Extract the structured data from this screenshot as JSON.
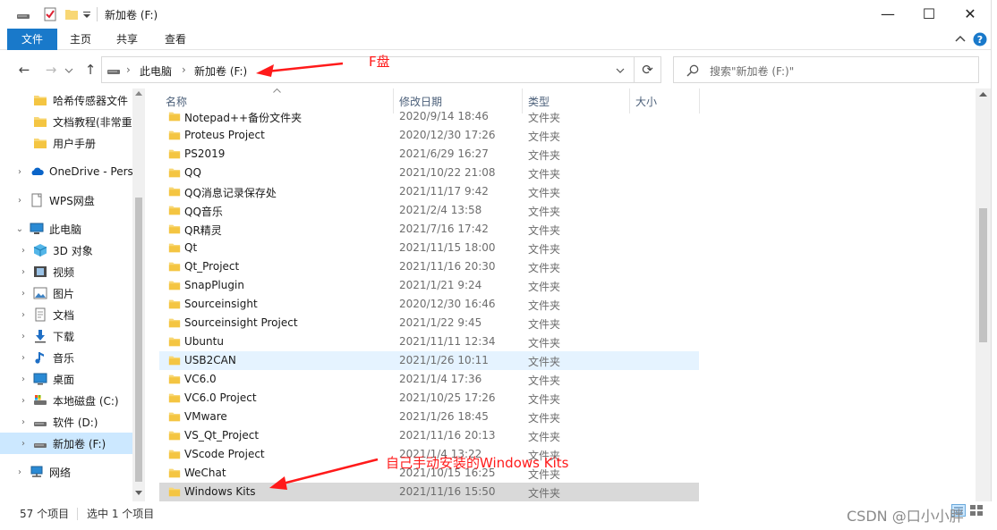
{
  "window": {
    "title": "新加卷 (F:)",
    "minimize_glyph": "—",
    "maximize_glyph": "☐",
    "close_glyph": "✕"
  },
  "ribbon": {
    "tabs": [
      {
        "label": "文件"
      },
      {
        "label": "主页"
      },
      {
        "label": "共享"
      },
      {
        "label": "查看"
      }
    ]
  },
  "nav": {
    "back_glyph": "←",
    "forward_glyph": "→",
    "up_glyph": "↑",
    "refresh_glyph": "⟳",
    "breadcrumb": [
      "此电脑",
      "新加卷 (F:)"
    ],
    "search_placeholder": "搜索\"新加卷 (F:)\""
  },
  "sidebar": {
    "items": [
      {
        "label": "哈希传感器文件",
        "icon": "folder-icon"
      },
      {
        "label": "文档教程(非常重",
        "icon": "folder-icon"
      },
      {
        "label": "用户手册",
        "icon": "folder-icon"
      },
      {
        "label": "OneDrive - Perso",
        "icon": "cloud-icon"
      },
      {
        "label": "WPS网盘",
        "icon": "cloud-drive-icon"
      },
      {
        "label": "此电脑",
        "icon": "computer-icon"
      },
      {
        "label": "3D 对象",
        "icon": "cube-icon"
      },
      {
        "label": "视频",
        "icon": "video-icon"
      },
      {
        "label": "图片",
        "icon": "picture-icon"
      },
      {
        "label": "文档",
        "icon": "document-icon"
      },
      {
        "label": "下载",
        "icon": "download-icon"
      },
      {
        "label": "音乐",
        "icon": "music-icon"
      },
      {
        "label": "桌面",
        "icon": "desktop-icon"
      },
      {
        "label": "本地磁盘 (C:)",
        "icon": "system-drive-icon"
      },
      {
        "label": "软件 (D:)",
        "icon": "drive-icon"
      },
      {
        "label": "新加卷 (F:)",
        "icon": "drive-icon"
      },
      {
        "label": "网络",
        "icon": "network-icon"
      }
    ]
  },
  "columns": {
    "name": "名称",
    "date": "修改日期",
    "type": "类型",
    "size": "大小"
  },
  "files": [
    {
      "name": "Notepad++备份文件夹",
      "date": "2020/9/14 18:46",
      "type": "文件夹"
    },
    {
      "name": "Proteus Project",
      "date": "2020/12/30 17:26",
      "type": "文件夹"
    },
    {
      "name": "PS2019",
      "date": "2021/6/29 16:27",
      "type": "文件夹"
    },
    {
      "name": "QQ",
      "date": "2021/10/22 21:08",
      "type": "文件夹"
    },
    {
      "name": "QQ消息记录保存处",
      "date": "2021/11/17 9:42",
      "type": "文件夹"
    },
    {
      "name": "QQ音乐",
      "date": "2021/2/4 13:58",
      "type": "文件夹"
    },
    {
      "name": "QR精灵",
      "date": "2021/7/16 17:42",
      "type": "文件夹"
    },
    {
      "name": "Qt",
      "date": "2021/11/15 18:00",
      "type": "文件夹"
    },
    {
      "name": "Qt_Project",
      "date": "2021/11/16 20:30",
      "type": "文件夹"
    },
    {
      "name": "SnapPlugin",
      "date": "2021/1/21 9:24",
      "type": "文件夹"
    },
    {
      "name": "Sourceinsight",
      "date": "2020/12/30 16:46",
      "type": "文件夹"
    },
    {
      "name": "Sourceinsight Project",
      "date": "2021/1/22 9:45",
      "type": "文件夹"
    },
    {
      "name": "Ubuntu",
      "date": "2021/11/11 12:34",
      "type": "文件夹"
    },
    {
      "name": "USB2CAN",
      "date": "2021/1/26 10:11",
      "type": "文件夹"
    },
    {
      "name": "VC6.0",
      "date": "2021/1/4 17:36",
      "type": "文件夹"
    },
    {
      "name": "VC6.0 Project",
      "date": "2021/10/25 17:26",
      "type": "文件夹"
    },
    {
      "name": "VMware",
      "date": "2021/1/26 18:45",
      "type": "文件夹"
    },
    {
      "name": "VS_Qt_Project",
      "date": "2021/11/16 20:13",
      "type": "文件夹"
    },
    {
      "name": "VScode Project",
      "date": "2021/1/4 13:22",
      "type": "文件夹"
    },
    {
      "name": "WeChat",
      "date": "2021/10/15 16:25",
      "type": "文件夹"
    },
    {
      "name": "Windows Kits",
      "date": "2021/11/16 15:50",
      "type": "文件夹"
    }
  ],
  "status": {
    "count": "57 个项目",
    "selected": "选中 1 个项目"
  },
  "annotations": {
    "drive_label": "F盘",
    "kits_label": "自己手动安装的Windows Kits",
    "color": "#ff1a1a"
  },
  "watermark": "CSDN @口小小胖",
  "colors": {
    "accent": "#1979ca",
    "folder": "#f8d775",
    "selected_row": "#d9d9d9",
    "hover_row": "#e5f3ff",
    "sidebar_selected": "#cce8ff"
  }
}
